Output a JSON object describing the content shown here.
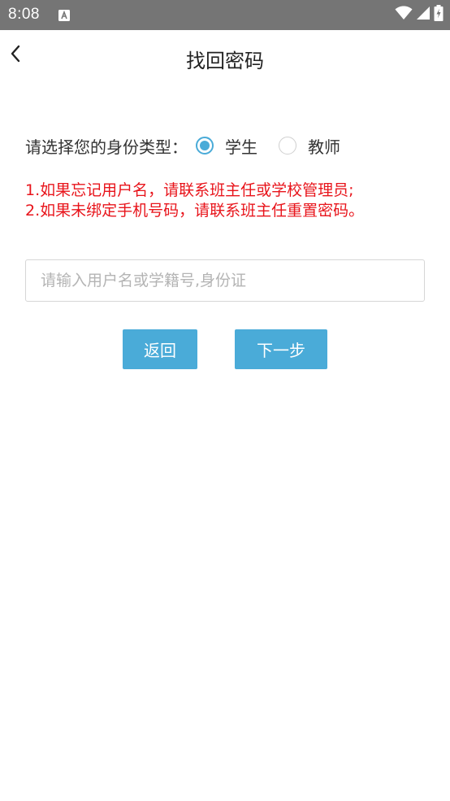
{
  "status_bar": {
    "time": "8:08",
    "notification_icon": "a-letter-icon",
    "icons": [
      "wifi-icon",
      "cellular-signal-icon",
      "battery-charging-icon"
    ],
    "background_color": "#757575"
  },
  "header": {
    "back_icon": "chevron-left-icon",
    "title": "找回密码"
  },
  "identity": {
    "label": "请选择您的身份类型：",
    "options": [
      {
        "label": "学生",
        "selected": true
      },
      {
        "label": "教师",
        "selected": false
      }
    ],
    "accent_color": "#4aabd8"
  },
  "notes": {
    "line1": "1.如果忘记用户名，请联系班主任或学校管理员;",
    "line2": "2.如果未绑定手机号码，请联系班主任重置密码。",
    "color": "#e8141b"
  },
  "form": {
    "account_value": "",
    "account_placeholder": "请输入用户名或学籍号,身份证"
  },
  "actions": {
    "back_label": "返回",
    "next_label": "下一步",
    "button_color": "#4aabd8"
  }
}
